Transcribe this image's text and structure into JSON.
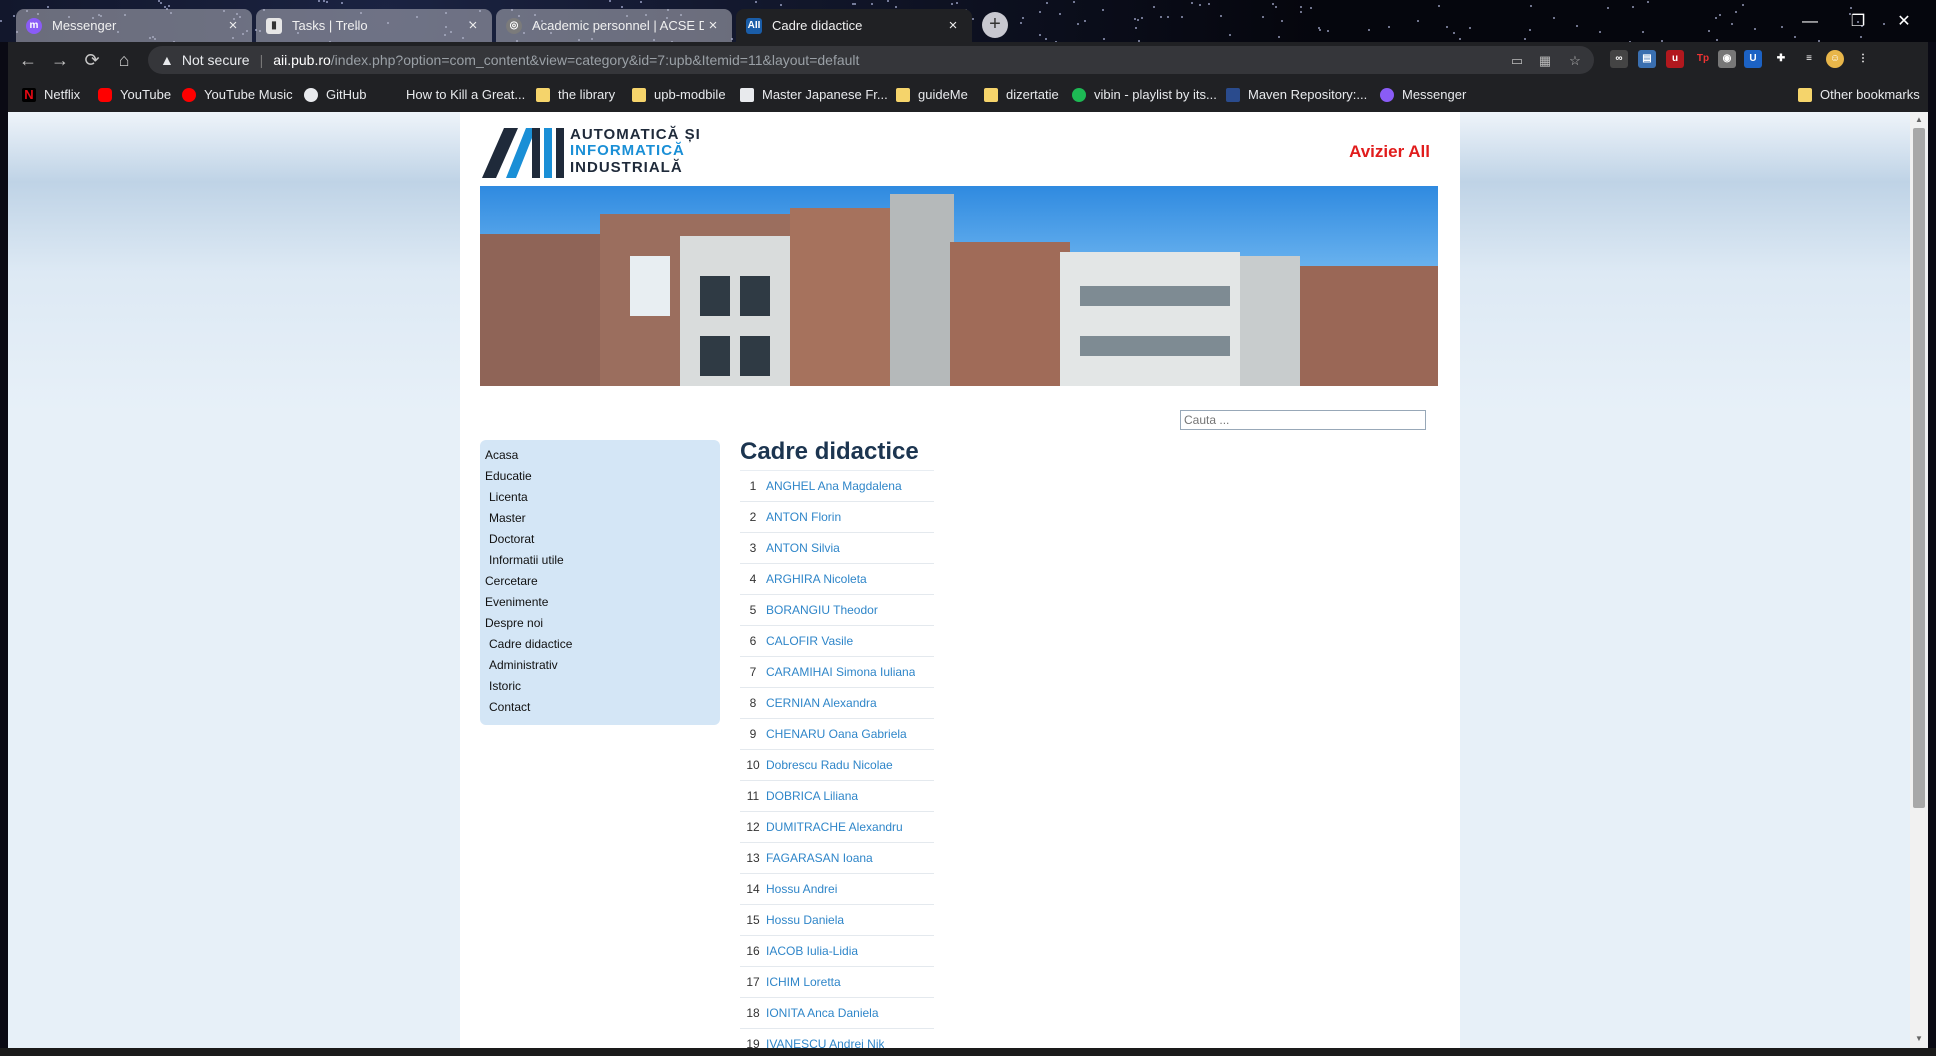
{
  "browser": {
    "tabs": [
      {
        "title": "Messenger",
        "active": false
      },
      {
        "title": "Tasks | Trello",
        "active": false
      },
      {
        "title": "Academic personnel | ACSE Dep...",
        "active": false
      },
      {
        "title": "Cadre didactice",
        "active": true
      }
    ],
    "new_tab": "+",
    "window": {
      "minimize": "—",
      "maximize": "❐",
      "close": "✕"
    },
    "nav": {
      "back": "←",
      "forward": "→",
      "reload": "⟳",
      "home": "⌂"
    },
    "address": {
      "security": "Not secure",
      "host": "aii.pub.ro",
      "path": "/index.php?option=com_content&view=category&id=7:upb&Itemid=11&layout=default"
    },
    "bookmarks": [
      "Netflix",
      "YouTube",
      "YouTube Music",
      "GitHub",
      "How to Kill a Great...",
      "the library",
      "upb-modbile",
      "Master Japanese Fr...",
      "guideMe",
      "dizertatie",
      "vibin - playlist by its...",
      "Maven Repository:...",
      "Messenger"
    ],
    "other_bookmarks": "Other bookmarks"
  },
  "site": {
    "logo": {
      "line1": "AUTOMATICĂ ȘI",
      "line2": "INFORMATICĂ",
      "line3": "INDUSTRIALĂ"
    },
    "avizier": "Avizier All",
    "search_placeholder": "Cauta ...",
    "menu": [
      {
        "label": "Acasa",
        "sub": false
      },
      {
        "label": "Educatie",
        "sub": false
      },
      {
        "label": "Licenta",
        "sub": true
      },
      {
        "label": "Master",
        "sub": true
      },
      {
        "label": "Doctorat",
        "sub": true
      },
      {
        "label": "Informatii utile",
        "sub": true
      },
      {
        "label": "Cercetare",
        "sub": false
      },
      {
        "label": "Evenimente",
        "sub": false
      },
      {
        "label": "Despre noi",
        "sub": false
      },
      {
        "label": "Cadre didactice",
        "sub": true
      },
      {
        "label": "Administrativ",
        "sub": true
      },
      {
        "label": "Istoric",
        "sub": true
      },
      {
        "label": "Contact",
        "sub": true
      }
    ],
    "page_title": "Cadre didactice",
    "staff": [
      {
        "n": "1",
        "name": "ANGHEL Ana Magdalena"
      },
      {
        "n": "2",
        "name": "ANTON Florin"
      },
      {
        "n": "3",
        "name": "ANTON Silvia"
      },
      {
        "n": "4",
        "name": "ARGHIRA Nicoleta"
      },
      {
        "n": "5",
        "name": "BORANGIU Theodor"
      },
      {
        "n": "6",
        "name": "CALOFIR Vasile"
      },
      {
        "n": "7",
        "name": "CARAMIHAI Simona Iuliana"
      },
      {
        "n": "8",
        "name": "CERNIAN Alexandra"
      },
      {
        "n": "9",
        "name": "CHENARU Oana Gabriela"
      },
      {
        "n": "10",
        "name": "Dobrescu Radu Nicolae"
      },
      {
        "n": "11",
        "name": "DOBRICA Liliana"
      },
      {
        "n": "12",
        "name": "DUMITRACHE Alexandru"
      },
      {
        "n": "13",
        "name": "FAGARASAN Ioana"
      },
      {
        "n": "14",
        "name": "Hossu Andrei"
      },
      {
        "n": "15",
        "name": "Hossu Daniela"
      },
      {
        "n": "16",
        "name": "IACOB Iulia-Lidia"
      },
      {
        "n": "17",
        "name": "ICHIM Loretta"
      },
      {
        "n": "18",
        "name": "IONITA Anca Daniela"
      },
      {
        "n": "19",
        "name": "IVANESCU Andrei Nik"
      }
    ]
  },
  "colors": {
    "accent_link": "#2f86c9",
    "avizier_red": "#e11c1c",
    "sidebar_bg": "#d4e6f6",
    "title": "#1c3550"
  }
}
